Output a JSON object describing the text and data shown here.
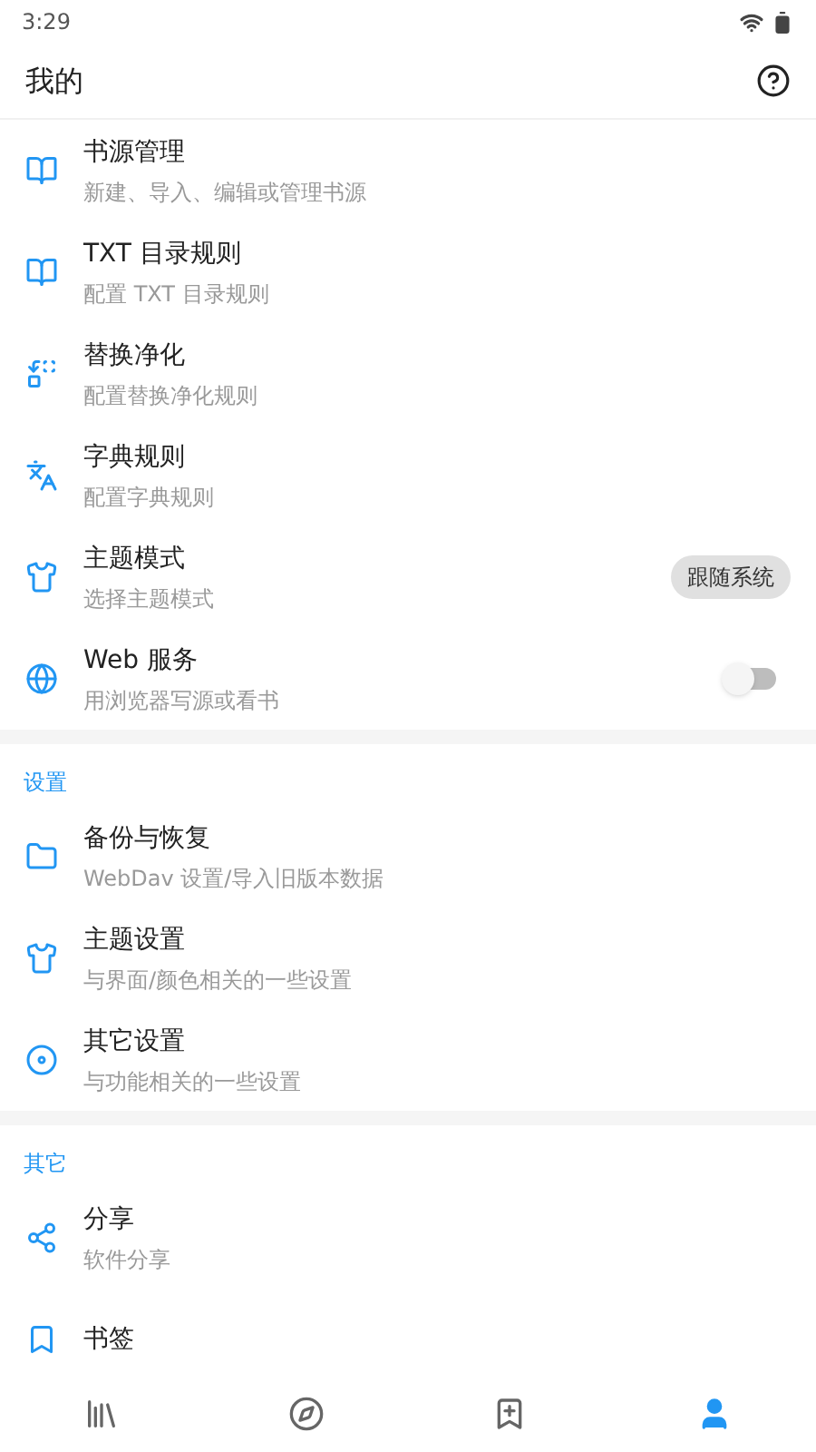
{
  "status_bar": {
    "time": "3:29"
  },
  "header": {
    "title": "我的"
  },
  "sections": [
    {
      "items": [
        {
          "kind": "plain",
          "title": "书源管理",
          "subtitle": "新建、导入、编辑或管理书源"
        },
        {
          "kind": "plain",
          "title": "TXT 目录规则",
          "subtitle": "配置 TXT 目录规则"
        },
        {
          "kind": "plain",
          "title": "替换净化",
          "subtitle": "配置替换净化规则"
        },
        {
          "kind": "plain",
          "title": "字典规则",
          "subtitle": "配置字典规则"
        },
        {
          "kind": "chip",
          "title": "主题模式",
          "subtitle": "选择主题模式",
          "value": "跟随系统"
        },
        {
          "kind": "switch",
          "title": "Web 服务",
          "subtitle": "用浏览器写源或看书",
          "on": false
        }
      ]
    },
    {
      "title": "设置",
      "items": [
        {
          "kind": "plain",
          "title": "备份与恢复",
          "subtitle": "WebDav 设置/导入旧版本数据"
        },
        {
          "kind": "plain",
          "title": "主题设置",
          "subtitle": "与界面/颜色相关的一些设置"
        },
        {
          "kind": "plain",
          "title": "其它设置",
          "subtitle": "与功能相关的一些设置"
        }
      ]
    },
    {
      "title": "其它",
      "items": [
        {
          "kind": "plain",
          "title": "分享",
          "subtitle": "软件分享"
        },
        {
          "kind": "plain",
          "title": "书签"
        }
      ]
    }
  ],
  "bottom_nav": [
    {
      "selected": false
    },
    {
      "selected": false
    },
    {
      "selected": false
    },
    {
      "selected": true
    }
  ]
}
